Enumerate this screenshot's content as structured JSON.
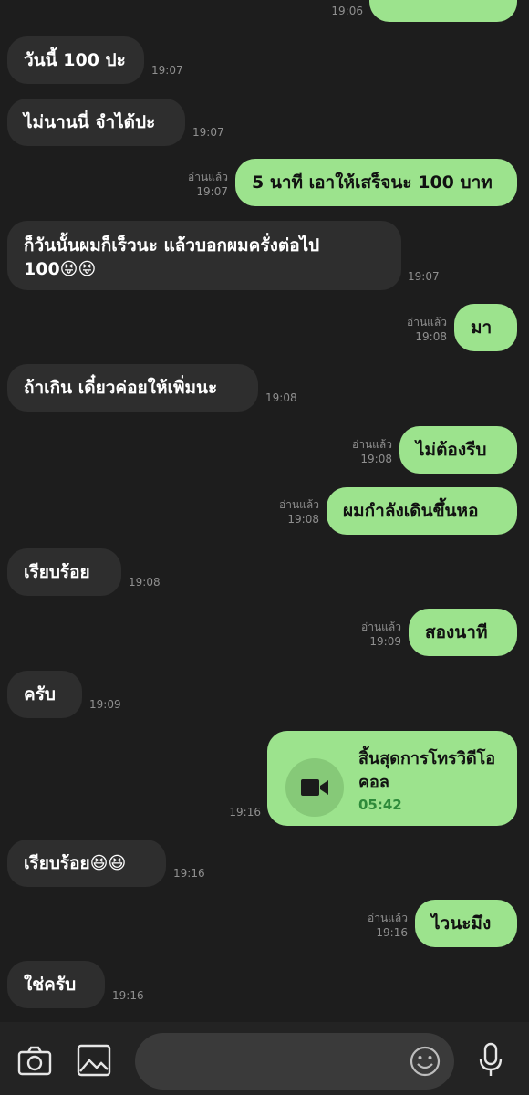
{
  "messages": [
    {
      "side": "out",
      "text": "",
      "time": "19:06",
      "read": ""
    },
    {
      "side": "in",
      "text": "วันนี้ 100 ปะ",
      "time": "19:07"
    },
    {
      "side": "in",
      "text": "ไม่นานนี่ จำได้ปะ",
      "time": "19:07"
    },
    {
      "side": "out",
      "text": "5 นาที เอาให้เสร็จนะ 100 บาท",
      "time": "19:07",
      "read": "อ่านแล้ว"
    },
    {
      "side": "in",
      "text": "ก็วันนั้นผมก็เร็วนะ แล้วบอกผมครั่งต่อไป 100😝😝",
      "time": "19:07"
    },
    {
      "side": "out",
      "text": "มา",
      "time": "19:08",
      "read": "อ่านแล้ว"
    },
    {
      "side": "in",
      "text": "ถ้าเกิน เดี๋ยวค่อยให้เพิ่มนะ",
      "time": "19:08"
    },
    {
      "side": "out",
      "text": "ไม่ต้องรีบ",
      "time": "19:08",
      "read": "อ่านแล้ว"
    },
    {
      "side": "out",
      "text": "ผมกำลังเดินขึ้นหอ",
      "time": "19:08",
      "read": "อ่านแล้ว"
    },
    {
      "side": "in",
      "text": "เรียบร้อย",
      "time": "19:08"
    },
    {
      "side": "out",
      "text": "สองนาที",
      "time": "19:09",
      "read": "อ่านแล้ว"
    },
    {
      "side": "in",
      "text": "ครับ",
      "time": "19:09"
    },
    {
      "side": "out",
      "type": "call",
      "text": "สิ้นสุดการโทรวิดีโอคอล",
      "duration": "05:42",
      "time": "19:16"
    },
    {
      "side": "in",
      "text": "เรียบร้อย😆😆",
      "time": "19:16"
    },
    {
      "side": "out",
      "text": "ไวนะมึง",
      "time": "19:16",
      "read": "อ่านแล้ว"
    },
    {
      "side": "in",
      "text": "ใช่ครับ",
      "time": "19:16"
    }
  ],
  "bottom_bar": {
    "icons": [
      "camera-icon",
      "image-icon",
      "emoji-icon",
      "microphone-icon"
    ],
    "input_value": ""
  },
  "colors": {
    "outgoing": "#9ce38d",
    "incoming": "#2e2e2e",
    "background": "#1d1d1d"
  }
}
